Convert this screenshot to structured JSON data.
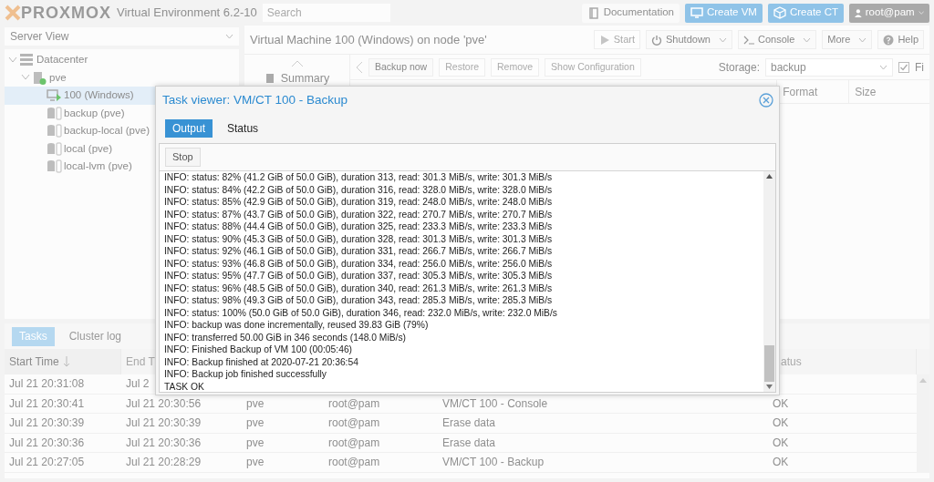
{
  "header": {
    "logo": "PROXMOX",
    "version": "Virtual Environment 6.2-10",
    "search": {
      "placeholder": "Search"
    },
    "buttons": [
      {
        "label": "Documentation",
        "kind": "docs"
      },
      {
        "label": "Create VM",
        "kind": "vm"
      },
      {
        "label": "Create CT",
        "kind": "ct"
      }
    ],
    "user": "root@pam"
  },
  "sidebar": {
    "view": "Server View",
    "tree": [
      {
        "label": "Datacenter",
        "kind": "datacenter",
        "selected": false,
        "expanded": true,
        "children": [
          {
            "label": "pve",
            "kind": "node",
            "selected": false,
            "expanded": true,
            "children": [
              {
                "label": "100 (Windows)",
                "kind": "vm",
                "selected": true
              },
              {
                "label": "backup (pve)",
                "kind": "storage",
                "selected": false
              },
              {
                "label": "backup-local (pve)",
                "kind": "storage",
                "selected": false
              },
              {
                "label": "local (pve)",
                "kind": "storage",
                "selected": false
              },
              {
                "label": "local-lvm (pve)",
                "kind": "storage",
                "selected": false
              }
            ]
          }
        ]
      }
    ]
  },
  "content": {
    "title": "Virtual Machine 100 (Windows) on node 'pve'",
    "actions": [
      {
        "label": "Start",
        "kind": "start",
        "disabled": true
      },
      {
        "label": "Shutdown",
        "kind": "shutdown",
        "disabled": false
      },
      {
        "label": "Console",
        "kind": "console",
        "disabled": false
      },
      {
        "label": "More",
        "kind": "more",
        "disabled": false
      },
      {
        "label": "Help",
        "kind": "help",
        "disabled": false
      }
    ],
    "nav": [
      {
        "label": "Summary",
        "selected": false
      }
    ],
    "backup_toolbar": {
      "buttons": [
        {
          "label": "Backup now",
          "disabled": false
        },
        {
          "label": "Restore",
          "disabled": true
        },
        {
          "label": "Remove",
          "disabled": true
        },
        {
          "label": "Show Configuration",
          "disabled": true
        }
      ],
      "storage_label": "Storage:",
      "storage_value": "backup",
      "filter": {
        "label": "Fi",
        "checked": true
      }
    },
    "backup_columns": [
      "Format",
      "Size"
    ]
  },
  "tasks": {
    "tabs": [
      {
        "label": "Tasks",
        "selected": true
      },
      {
        "label": "Cluster log",
        "selected": false
      }
    ],
    "columns": [
      {
        "label": "Start Time",
        "sorted": true
      },
      {
        "label": "End T",
        "sorted": false
      },
      {
        "label": "atus",
        "sorted": false
      }
    ],
    "rows": [
      {
        "cells": [
          "Jul 21 20:31:08",
          "Jul 2"
        ]
      },
      {
        "cells": [
          "Jul 21 20:30:41",
          "Jul 21 20:30:56",
          "pve",
          "root@pam",
          "VM/CT 100 - Console",
          "OK"
        ]
      },
      {
        "cells": [
          "Jul 21 20:30:39",
          "Jul 21 20:30:39",
          "pve",
          "root@pam",
          "Erase data",
          "OK"
        ]
      },
      {
        "cells": [
          "Jul 21 20:30:36",
          "Jul 21 20:30:36",
          "pve",
          "root@pam",
          "Erase data",
          "OK"
        ]
      },
      {
        "cells": [
          "Jul 21 20:27:05",
          "Jul 21 20:28:29",
          "pve",
          "root@pam",
          "VM/CT 100 - Backup",
          "OK"
        ]
      }
    ]
  },
  "task_viewer": {
    "title": "Task viewer: VM/CT 100 - Backup",
    "tabs": [
      {
        "label": "Output",
        "selected": true
      },
      {
        "label": "Status",
        "selected": false
      }
    ],
    "stop": "Stop",
    "log": [
      "INFO: status: 82% (41.2 GiB of 50.0 GiB), duration 313, read: 301.3 MiB/s, write: 301.3 MiB/s",
      "INFO: status: 84% (42.2 GiB of 50.0 GiB), duration 316, read: 328.0 MiB/s, write: 328.0 MiB/s",
      "INFO: status: 85% (42.9 GiB of 50.0 GiB), duration 319, read: 248.0 MiB/s, write: 248.0 MiB/s",
      "INFO: status: 87% (43.7 GiB of 50.0 GiB), duration 322, read: 270.7 MiB/s, write: 270.7 MiB/s",
      "INFO: status: 88% (44.4 GiB of 50.0 GiB), duration 325, read: 233.3 MiB/s, write: 233.3 MiB/s",
      "INFO: status: 90% (45.3 GiB of 50.0 GiB), duration 328, read: 301.3 MiB/s, write: 301.3 MiB/s",
      "INFO: status: 92% (46.1 GiB of 50.0 GiB), duration 331, read: 266.7 MiB/s, write: 266.7 MiB/s",
      "INFO: status: 93% (46.8 GiB of 50.0 GiB), duration 334, read: 256.0 MiB/s, write: 256.0 MiB/s",
      "INFO: status: 95% (47.7 GiB of 50.0 GiB), duration 337, read: 305.3 MiB/s, write: 305.3 MiB/s",
      "INFO: status: 96% (48.5 GiB of 50.0 GiB), duration 340, read: 261.3 MiB/s, write: 261.3 MiB/s",
      "INFO: status: 98% (49.3 GiB of 50.0 GiB), duration 343, read: 285.3 MiB/s, write: 285.3 MiB/s",
      "INFO: status: 100% (50.0 GiB of 50.0 GiB), duration 346, read: 232.0 MiB/s, write: 232.0 MiB/s",
      "INFO: backup was done incrementally, reused 39.83 GiB (79%)",
      "INFO: transferred 50.00 GiB in 346 seconds (148.0 MiB/s)",
      "INFO: Finished Backup of VM 100 (00:05:46)",
      "INFO: Backup finished at 2020-07-21 20:36:54",
      "INFO: Backup job finished successfully",
      "TASK OK"
    ]
  }
}
